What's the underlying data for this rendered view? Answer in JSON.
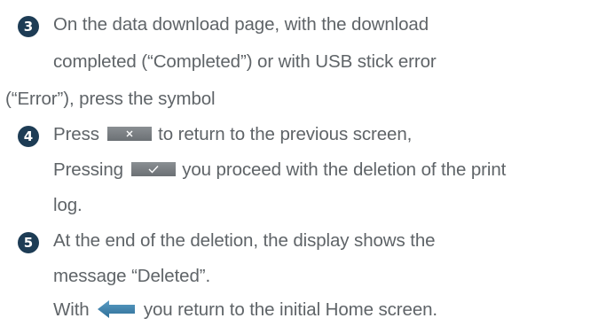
{
  "steps": [
    {
      "number": "3",
      "lines": [
        "On the data download page, with the download",
        "completed (“Completed”) or with USB stick error",
        "(“Error”), press the symbol"
      ]
    },
    {
      "number": "4",
      "line1_before": "Press",
      "line1_after": "to return to the previous screen,",
      "line2_before": "Pressing",
      "line2_after": "you proceed with the deletion of the print",
      "line3": "log."
    },
    {
      "number": "5",
      "lines": [
        "At the end of the deletion, the display shows the",
        "message “Deleted”."
      ],
      "last_before": "With",
      "last_after": "you return to the initial Home screen."
    }
  ],
  "icons": {
    "cancel": "x-key-icon",
    "confirm": "checkmark-key-icon",
    "back": "back-arrow-icon"
  },
  "colors": {
    "text": "#5f6468",
    "badge": "#1d3c55",
    "key": "#7a7f83",
    "arrow": "#3a7fa8"
  }
}
